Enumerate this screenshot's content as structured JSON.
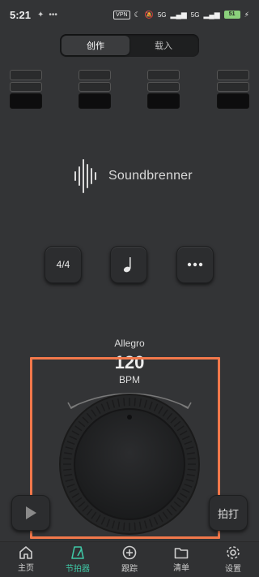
{
  "status": {
    "time": "5:21",
    "battery": "51",
    "vpn": "VPN",
    "signal1": "5G",
    "signal2": "5G"
  },
  "mode_tabs": [
    {
      "label": "创作",
      "active": true
    },
    {
      "label": "载入",
      "active": false
    }
  ],
  "beats": [
    {
      "levels": 3
    },
    {
      "levels": 3
    },
    {
      "levels": 3
    },
    {
      "levels": 3
    }
  ],
  "logo": {
    "text": "Soundbrenner",
    "icon": "soundwave-icon"
  },
  "controls": {
    "time_signature": "4/4",
    "note_icon": "quarter-note-icon",
    "more_icon": "more-dots-icon"
  },
  "tempo": {
    "name": "Allegro",
    "value": "120",
    "unit": "BPM"
  },
  "side_buttons": {
    "play_icon": "play-icon",
    "tap_label": "拍打"
  },
  "nav": [
    {
      "label": "主页",
      "icon": "home-icon",
      "active": false
    },
    {
      "label": "节拍器",
      "icon": "metronome-icon",
      "active": true
    },
    {
      "label": "跟踪",
      "icon": "plus-circle-icon",
      "active": false
    },
    {
      "label": "清单",
      "icon": "folder-icon",
      "active": false
    },
    {
      "label": "设置",
      "icon": "gear-icon",
      "active": false
    }
  ],
  "colors": {
    "background": "#333436",
    "accent": "#3fc7a6",
    "highlight": "#f2784b"
  }
}
